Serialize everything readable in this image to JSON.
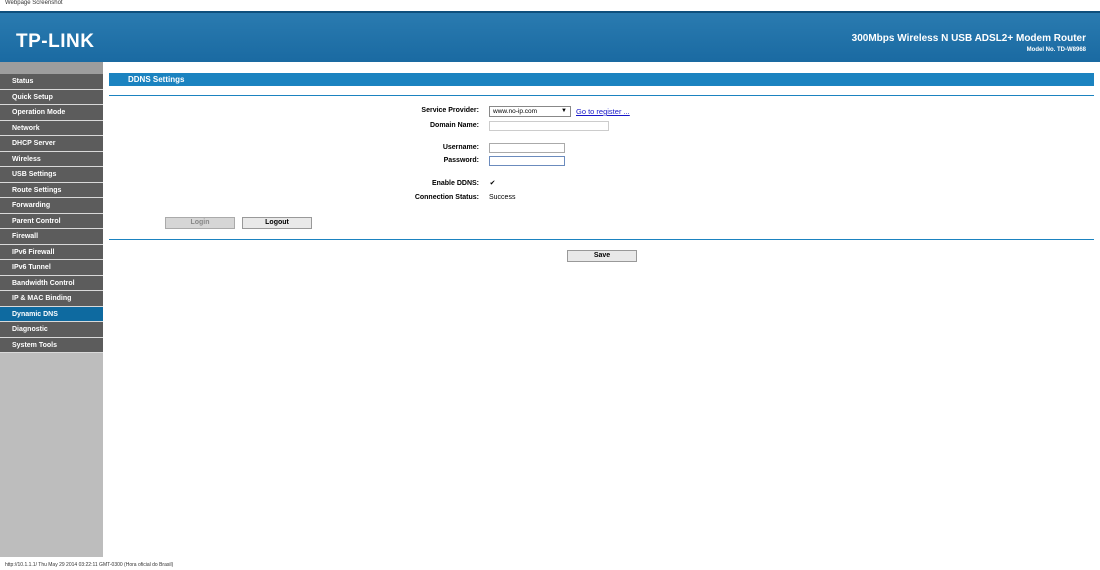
{
  "caption": "Webpage Screenshot",
  "header": {
    "logo": "TP-LINK",
    "product": "300Mbps Wireless N USB ADSL2+ Modem Router",
    "model": "Model No. TD-W8968"
  },
  "sidebar": {
    "items": [
      {
        "label": "Status"
      },
      {
        "label": "Quick Setup"
      },
      {
        "label": "Operation Mode"
      },
      {
        "label": "Network"
      },
      {
        "label": "DHCP Server"
      },
      {
        "label": "Wireless"
      },
      {
        "label": "USB Settings"
      },
      {
        "label": "Route Settings"
      },
      {
        "label": "Forwarding"
      },
      {
        "label": "Parent Control"
      },
      {
        "label": "Firewall"
      },
      {
        "label": "IPv6 Firewall"
      },
      {
        "label": "IPv6 Tunnel"
      },
      {
        "label": "Bandwidth Control"
      },
      {
        "label": "IP & MAC Binding"
      },
      {
        "label": "Dynamic DNS",
        "active": true
      },
      {
        "label": "Diagnostic"
      },
      {
        "label": "System Tools"
      }
    ]
  },
  "main": {
    "title": "DDNS Settings",
    "service_provider_label": "Service Provider:",
    "service_provider_value": "www.no-ip.com",
    "go_register": "Go to register ...",
    "domain_name_label": "Domain Name:",
    "domain_name_value": "",
    "username_label": "Username:",
    "username_value": "",
    "password_label": "Password:",
    "password_value": "",
    "enable_ddns_label": "Enable DDNS:",
    "enable_ddns_checked": true,
    "connection_status_label": "Connection Status:",
    "connection_status_value": "Success",
    "login_button": "Login",
    "logout_button": "Logout",
    "save_button": "Save"
  },
  "footer": "http://10.1.1.1/ Thu May 29 2014 03:22:11 GMT-0300 (Hora oficial do Brasil)",
  "colors": {
    "header": "#1a6aa2",
    "accent": "#1b83c0",
    "menu": "#5c5c5c",
    "menu_active": "#0e6aa0"
  }
}
